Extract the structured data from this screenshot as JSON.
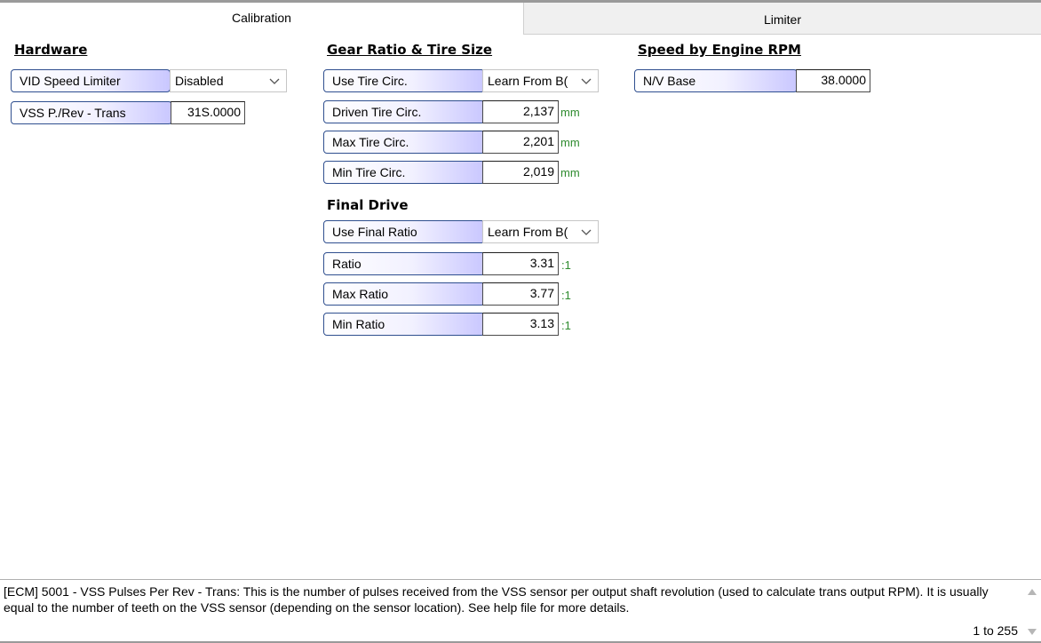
{
  "tabs": [
    {
      "label": "Calibration",
      "active": true
    },
    {
      "label": "Limiter",
      "active": false
    }
  ],
  "hardware": {
    "title": "Hardware",
    "vid_speed_limiter": {
      "label": "VID Speed Limiter",
      "value": "Disabled"
    },
    "vss_pulses": {
      "label": "VSS P./Rev - Trans",
      "value": "31S.0000"
    }
  },
  "gear_tire": {
    "title": "Gear Ratio & Tire Size",
    "use_tire_circ": {
      "label": "Use Tire Circ.",
      "value": "Learn From B("
    },
    "driven_tire_circ": {
      "label": "Driven Tire Circ.",
      "value": "2,137",
      "unit": "mm"
    },
    "max_tire_circ": {
      "label": "Max Tire Circ.",
      "value": "2,201",
      "unit": "mm"
    },
    "min_tire_circ": {
      "label": "Min Tire Circ.",
      "value": "2,019",
      "unit": "mm"
    }
  },
  "final_drive": {
    "title": "Final Drive",
    "use_final_ratio": {
      "label": "Use Final Ratio",
      "value": "Learn From B("
    },
    "ratio": {
      "label": "Ratio",
      "value": "3.31",
      "unit": ":1"
    },
    "max_ratio": {
      "label": "Max Ratio",
      "value": "3.77",
      "unit": ":1"
    },
    "min_ratio": {
      "label": "Min Ratio",
      "value": "3.13",
      "unit": ":1"
    }
  },
  "speed_rpm": {
    "title": "Speed by Engine RPM",
    "nv_base": {
      "label": "N/V Base",
      "value": "38.0000"
    }
  },
  "status": {
    "description": "[ECM] 5001 - VSS Pulses Per Rev - Trans: This is the number of pulses received from the VSS sensor per output shaft revolution (used to calculate trans output RPM). It is usually equal to the number of teeth on the VSS sensor (depending on the sensor location). See help file for more details.",
    "range": "1 to 255"
  },
  "icons": {
    "dropdown": "chevron-down-icon",
    "scroll_up": "scroll-up-arrow-icon",
    "scroll_down": "scroll-down-arrow-icon"
  },
  "colors": {
    "unit_green": "#2e8b2e",
    "label_border": "#2f4f8f",
    "label_gradient_end": "#c9c7ff"
  }
}
